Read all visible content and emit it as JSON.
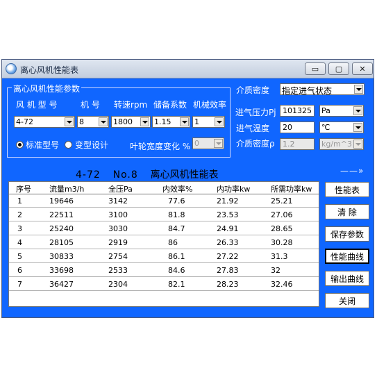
{
  "window": {
    "title": "离心风机性能表",
    "controls": {
      "minimize": "▭",
      "maximize": "▢",
      "close": "✕"
    }
  },
  "params_group": {
    "title": "离心风机性能参数",
    "headers": [
      "风 机 型 号",
      "机  号",
      "转速rpm",
      "储备系数",
      "机械效率"
    ],
    "selects": {
      "model": "4-72",
      "number": "8",
      "speed": "1800",
      "reserve": "1.15",
      "mech_eff": "1"
    },
    "radio_standard": "标准型号",
    "radio_variant": "变型设计",
    "radio_selected": "标准型号",
    "impeller_label": "叶轮宽度变化 %",
    "impeller_value": "0"
  },
  "medium": {
    "label": "介质密度",
    "mode": "指定进气状态",
    "pressure_label": "进气压力Pj",
    "pressure_value": "101325",
    "pressure_unit": "Pa",
    "temp_label": "进气温度",
    "temp_value": "20",
    "temp_unit": "℃",
    "density_label": "介质密度ρ",
    "density_value": "1.2",
    "density_unit": "kg/m^3"
  },
  "table_title": {
    "model": "4-72",
    "no": "No.8",
    "name": "离心风机性能表",
    "more": "——»"
  },
  "table": {
    "columns": [
      "序号",
      "流量m3/h",
      "全压Pa",
      "内效率%",
      "内功率kw",
      "所需功率kw"
    ],
    "rows": [
      [
        "1",
        "19646",
        "3142",
        "77.6",
        "21.92",
        "25.21"
      ],
      [
        "2",
        "22511",
        "3100",
        "81.8",
        "23.53",
        "27.06"
      ],
      [
        "3",
        "25240",
        "3030",
        "84.7",
        "24.91",
        "28.65"
      ],
      [
        "4",
        "28105",
        "2919",
        "86",
        "26.33",
        "30.28"
      ],
      [
        "5",
        "30833",
        "2754",
        "86.1",
        "27.22",
        "31.3"
      ],
      [
        "6",
        "33698",
        "2533",
        "84.6",
        "27.83",
        "32"
      ],
      [
        "7",
        "36427",
        "2304",
        "82.1",
        "28.23",
        "32.46"
      ]
    ]
  },
  "buttons": [
    "性能表",
    "清  除",
    "保存参数",
    "性能曲线",
    "输出曲线",
    "关闭"
  ],
  "colors": {
    "window_bg": "#1066ff",
    "label_text": "#ffffff"
  }
}
